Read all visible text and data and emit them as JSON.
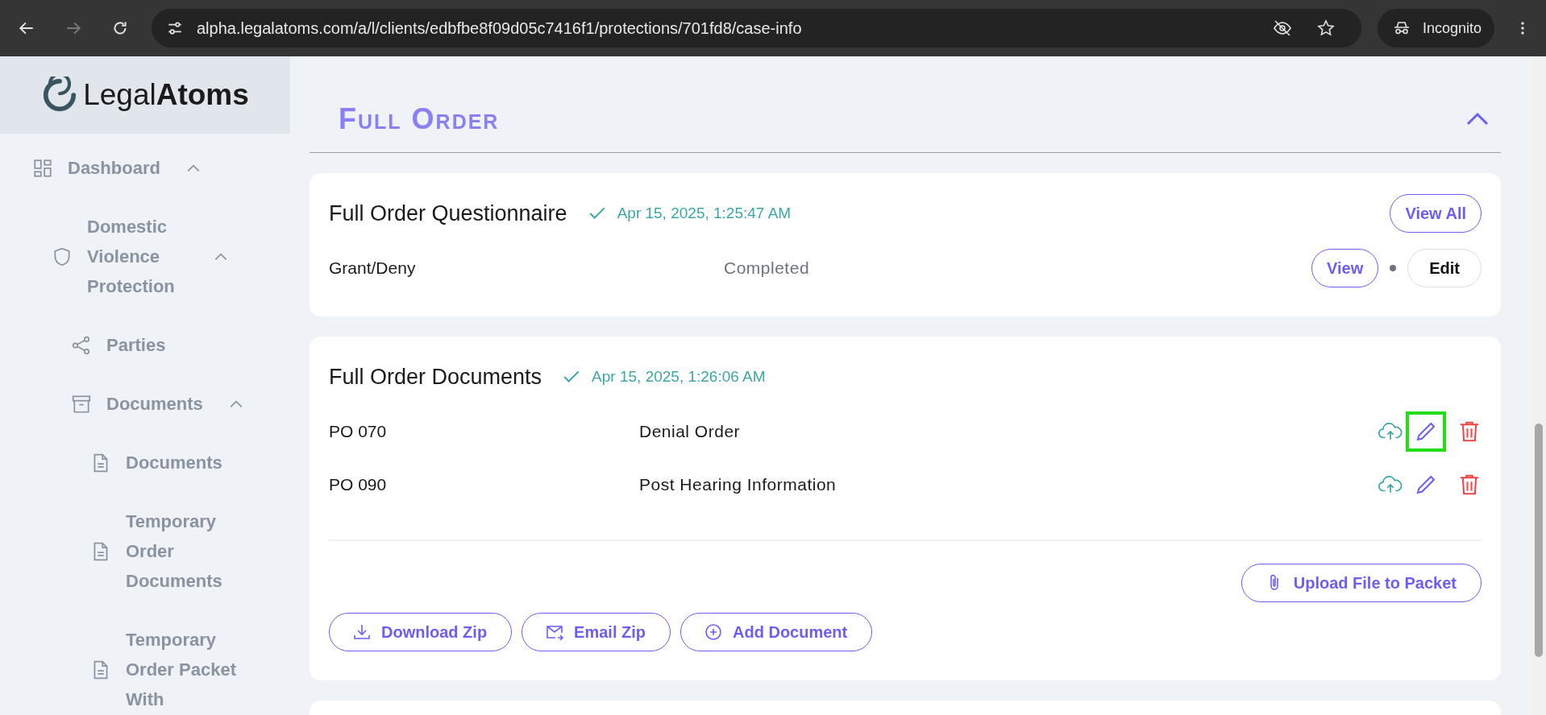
{
  "browser": {
    "url": "alpha.legalatoms.com/a/l/clients/edbfbe8f09d05c7416f1/protections/701fd8/case-info",
    "profile_label": "Incognito"
  },
  "brand": {
    "name": "Legal**Atoms**"
  },
  "sidebar": {
    "items": [
      {
        "label": "Dashboard",
        "kind": "dashboard",
        "expanded": true,
        "children": [
          {
            "label": "Domestic Violence Protection",
            "kind": "shield",
            "expanded": true,
            "children": [
              {
                "label": "Parties",
                "kind": "share"
              },
              {
                "label": "Documents",
                "kind": "archive",
                "expanded": true,
                "children": [
                  {
                    "label": "Documents",
                    "kind": "file"
                  },
                  {
                    "label": "Temporary Order Documents",
                    "kind": "file"
                  },
                  {
                    "label": "Temporary Order Packet With",
                    "kind": "file"
                  }
                ]
              }
            ]
          }
        ]
      }
    ]
  },
  "section": {
    "title": "Full Order",
    "expanded": true
  },
  "questionnaire": {
    "title": "Full Order Questionnaire",
    "completed": true,
    "timestamp": "Apr 15, 2025, 1:25:47 AM",
    "view_all_label": "View All",
    "rows": [
      {
        "name": "Grant/Deny",
        "status": "Completed",
        "view_label": "View",
        "edit_label": "Edit"
      }
    ]
  },
  "documents": {
    "title": "Full Order Documents",
    "completed": true,
    "timestamp": "Apr 15, 2025, 1:26:06 AM",
    "rows": [
      {
        "code": "PO 070",
        "name": "Denial Order",
        "edit_highlighted": true
      },
      {
        "code": "PO 090",
        "name": "Post Hearing Information",
        "edit_highlighted": false
      }
    ],
    "upload_label": "Upload File to Packet",
    "buttons": [
      {
        "label": "Download Zip",
        "kind": "download"
      },
      {
        "label": "Email Zip",
        "kind": "email"
      },
      {
        "label": "Add Document",
        "kind": "add"
      }
    ]
  }
}
